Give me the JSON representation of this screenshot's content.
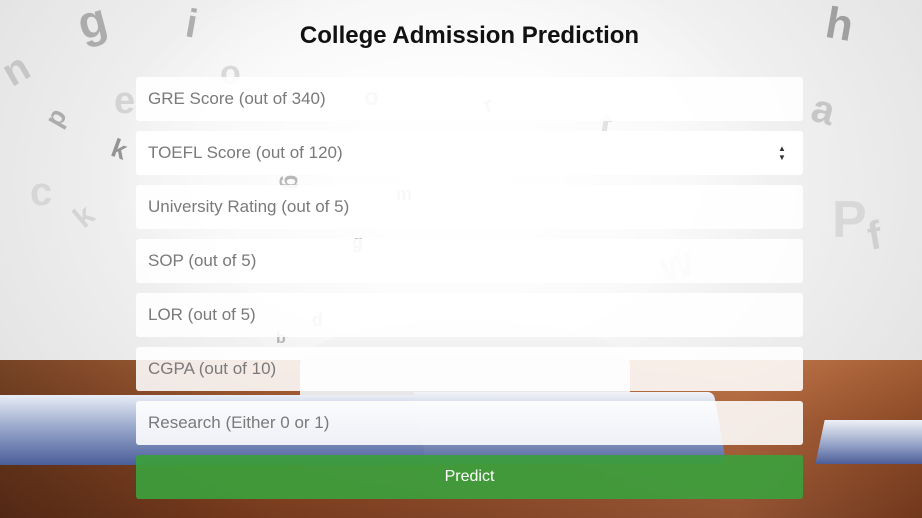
{
  "page": {
    "title": "College Admission Prediction"
  },
  "form": {
    "fields": [
      {
        "placeholder": "GRE Score (out of 340)",
        "value": ""
      },
      {
        "placeholder": "TOEFL Score (out of 120)",
        "value": ""
      },
      {
        "placeholder": "University Rating (out of 5)",
        "value": ""
      },
      {
        "placeholder": "SOP (out of 5)",
        "value": ""
      },
      {
        "placeholder": "LOR (out of 5)",
        "value": ""
      },
      {
        "placeholder": "CGPA (out of 10)",
        "value": ""
      },
      {
        "placeholder": "Research (Either 0 or 1)",
        "value": ""
      }
    ],
    "submit_label": "Predict",
    "spinner_up": "▲",
    "spinner_down": "▼"
  },
  "colors": {
    "submit_button": "#3ca03c",
    "title_text": "#111111"
  }
}
